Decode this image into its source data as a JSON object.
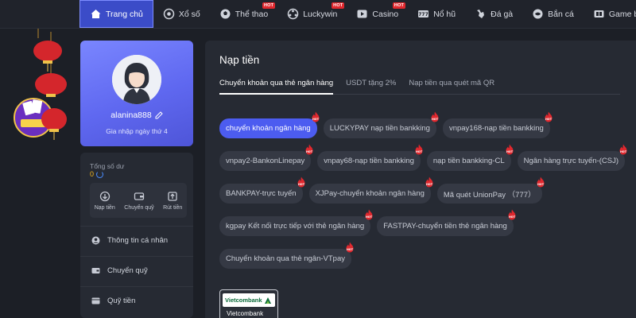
{
  "nav": {
    "items": [
      {
        "label": "Trang chủ",
        "icon": "home-icon",
        "hot": false,
        "active": true
      },
      {
        "label": "Xổ số",
        "icon": "lottery-icon",
        "hot": false,
        "active": false
      },
      {
        "label": "Thể thao",
        "icon": "sports-icon",
        "hot": true,
        "active": false
      },
      {
        "label": "Luckywin",
        "icon": "luckywin-icon",
        "hot": true,
        "active": false
      },
      {
        "label": "Casino",
        "icon": "casino-icon",
        "hot": true,
        "active": false
      },
      {
        "label": "Nổ hũ",
        "icon": "slot-icon",
        "hot": false,
        "active": false
      },
      {
        "label": "Đá gà",
        "icon": "rooster-icon",
        "hot": false,
        "active": false
      },
      {
        "label": "Bắn cá",
        "icon": "fish-icon",
        "hot": false,
        "active": false
      },
      {
        "label": "Game bài",
        "icon": "cards-icon",
        "hot": false,
        "active": false
      }
    ],
    "hot_label": "HOT"
  },
  "profile": {
    "username": "alanina888",
    "joined": "Gia nhập ngày thứ 4"
  },
  "balance": {
    "label": "Tổng số dư",
    "value": "0"
  },
  "quick_actions": [
    {
      "label": "Nạp tiền",
      "icon": "deposit-icon"
    },
    {
      "label": "Chuyển quỹ",
      "icon": "transfer-icon"
    },
    {
      "label": "Rút tiền",
      "icon": "withdraw-icon"
    }
  ],
  "menu": [
    {
      "label": "Thông tin cá nhân",
      "icon": "user-icon"
    },
    {
      "label": "Chuyển quỹ",
      "icon": "wallet-icon"
    },
    {
      "label": "Quỹ tiền",
      "icon": "funds-icon"
    }
  ],
  "main": {
    "title": "Nạp tiền",
    "tabs": [
      {
        "label": "Chuyển khoản qua thẻ ngân hàng",
        "active": true
      },
      {
        "label": "USDT tặng 2%",
        "active": false
      },
      {
        "label": "Nạp tiền qua quét mã QR",
        "active": false
      }
    ],
    "method_rows": [
      [
        {
          "label": "chuyển khoản ngân hàng",
          "hot": true,
          "active": true
        },
        {
          "label": "LUCKYPAY nạp tiền bankking",
          "hot": true,
          "active": false
        },
        {
          "label": "vnpay168-nạp tiền bankking",
          "hot": true,
          "active": false
        }
      ],
      [
        {
          "label": "vnpay2-BankonLinepay",
          "hot": true,
          "active": false
        },
        {
          "label": "vnpay68-nạp tiền bankking",
          "hot": true,
          "active": false
        },
        {
          "label": "nạp tiền bankking-CL",
          "hot": true,
          "active": false
        },
        {
          "label": "Ngân hàng trực tuyến-(CSJ)",
          "hot": true,
          "active": false
        }
      ],
      [
        {
          "label": "BANKPAY-trực tuyến",
          "hot": true,
          "active": false
        },
        {
          "label": "XJPay-chuyển khoản ngân hàng",
          "hot": true,
          "active": false
        },
        {
          "label": "Mã quét UnionPay （777）",
          "hot": true,
          "active": false
        }
      ],
      [
        {
          "label": "kgpay Kết nối trực tiếp với thẻ ngân hàng",
          "hot": true,
          "active": false
        },
        {
          "label": "FASTPAY-chuyển tiền thẻ ngân hàng",
          "hot": true,
          "active": false
        }
      ],
      [
        {
          "label": "Chuyển khoản qua thẻ ngân-VTpay",
          "hot": true,
          "active": false
        }
      ]
    ],
    "bank": {
      "logo_text": "Vietcombank",
      "caption": "Vietcombank"
    }
  },
  "colors": {
    "accent": "#4c5cf0",
    "active_nav": "#3b4cc8",
    "background": "#1c1f26",
    "panel": "#262a33",
    "hot": "#e0282e",
    "balance": "#f3b51d"
  }
}
